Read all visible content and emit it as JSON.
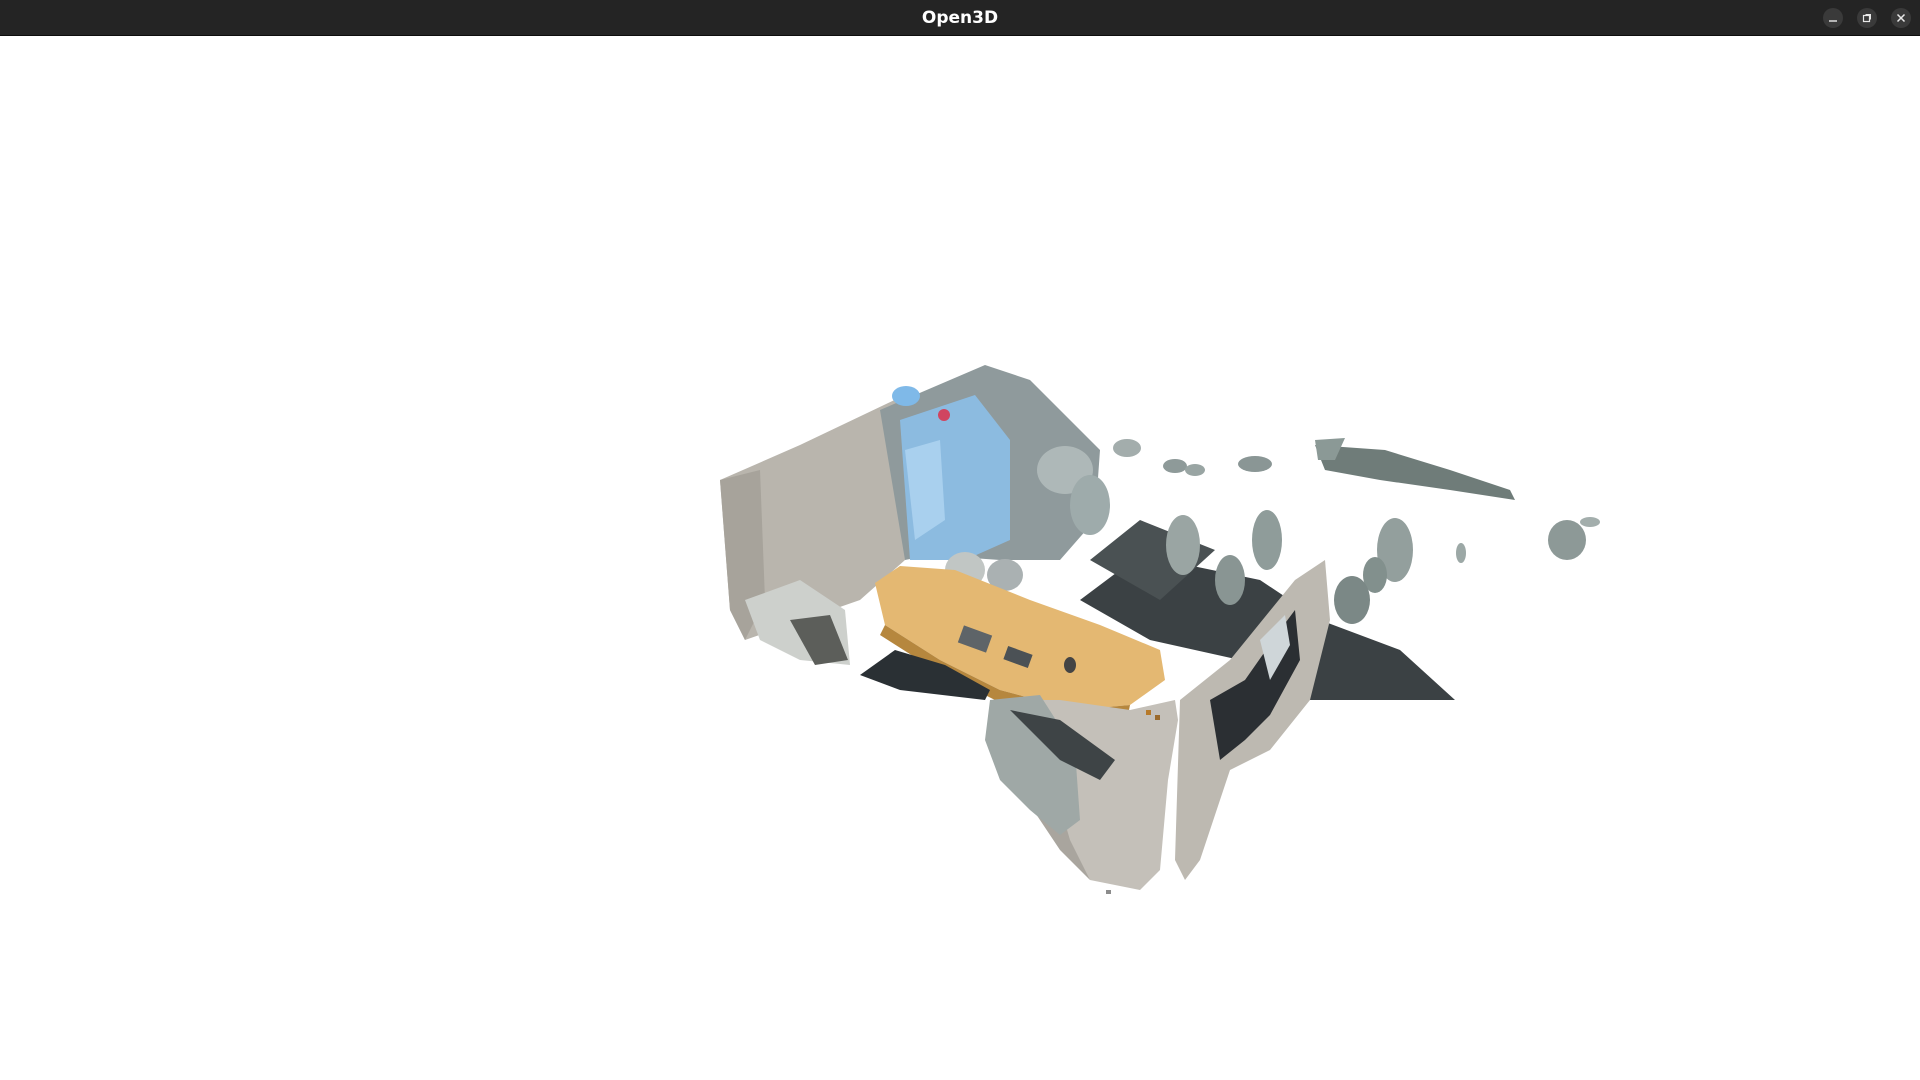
{
  "window": {
    "title": "Open3D",
    "controls": {
      "minimize_icon": "minimize-icon",
      "maximize_icon": "maximize-icon",
      "close_icon": "close-icon"
    }
  },
  "viewport": {
    "background": "#ffffff",
    "content": "point-cloud-scene"
  },
  "colors": {
    "titlebar": "#242424",
    "title_text": "#ffffff",
    "wall": "#bdbab3",
    "wall_shade": "#9f9b93",
    "table": "#e2b66e",
    "floor_dark": "#2f3336",
    "glass_blue": "#7fb2d6",
    "gray_green": "#7d8986"
  }
}
